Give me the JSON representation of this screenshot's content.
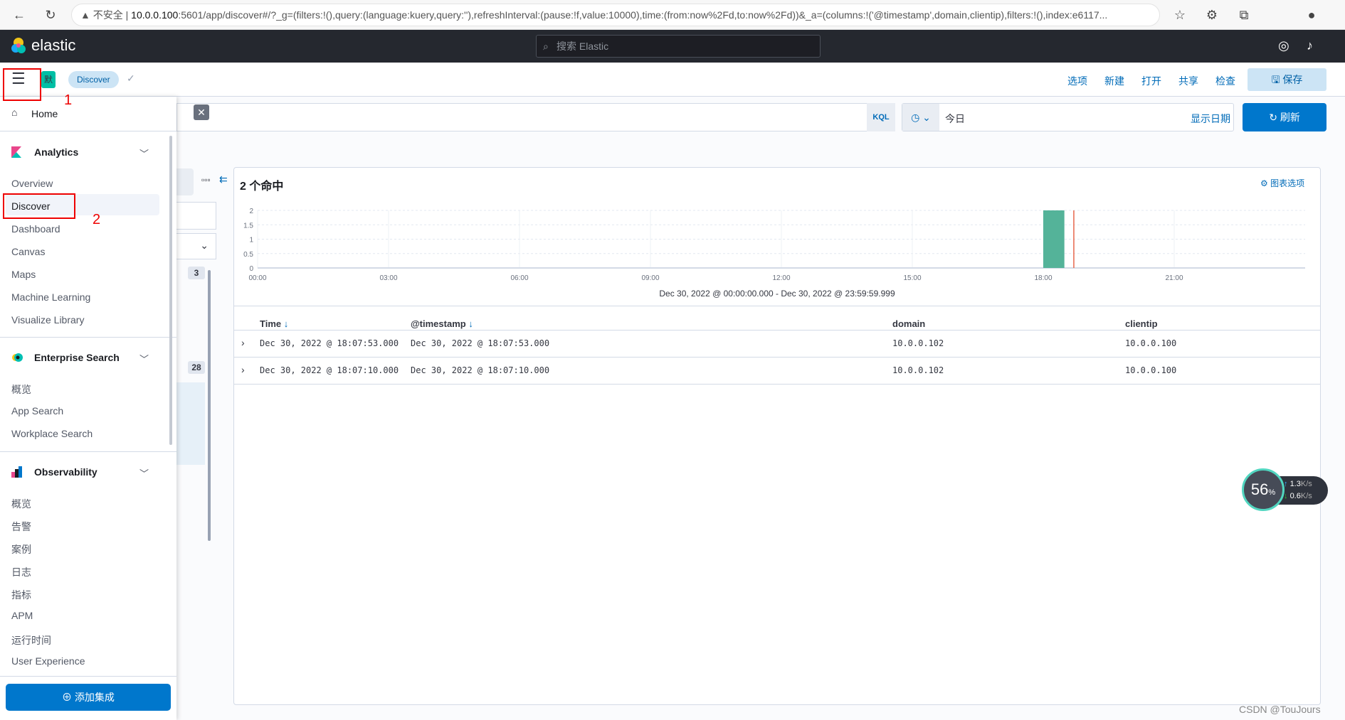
{
  "browser": {
    "security": "不安全",
    "host": "10.0.0.100",
    "url_rest": ":5601/app/discover#/?_g=(filters:!(),query:(language:kuery,query:''),refreshInterval:(pause:!f,value:10000),time:(from:now%2Fd,to:now%2Fd))&_a=(columns:!('@timestamp',domain,clientip),filters:!(),index:e6117..."
  },
  "header": {
    "logo": "elastic",
    "search_placeholder": "搜索 Elastic"
  },
  "subbar": {
    "space_badge": "默",
    "breadcrumb": "Discover",
    "links": [
      "选项",
      "新建",
      "打开",
      "共享",
      "检查"
    ],
    "save": "保存"
  },
  "query": {
    "language": "KQL",
    "date": "今日",
    "show_dates": "显示日期",
    "refresh": "刷新"
  },
  "sidebar": {
    "home": "Home",
    "groups": [
      {
        "title": "Analytics",
        "items": [
          "Overview",
          "Discover",
          "Dashboard",
          "Canvas",
          "Maps",
          "Machine Learning",
          "Visualize Library"
        ]
      },
      {
        "title": "Enterprise Search",
        "items": [
          "概览",
          "App Search",
          "Workplace Search"
        ]
      },
      {
        "title": "Observability",
        "items": [
          "概览",
          "告警",
          "案例",
          "日志",
          "指标",
          "APM",
          "运行时间",
          "User Experience"
        ]
      }
    ],
    "add_integration": "添加集成",
    "active": "Discover"
  },
  "fields": {
    "badge_a": "3",
    "badge_b": "28"
  },
  "annotations": {
    "step1": "1",
    "step2": "2"
  },
  "results": {
    "hits": "2 个命中",
    "chart_options": "图表选项",
    "range": "Dec 30, 2022 @ 00:00:00.000 - Dec 30, 2022 @ 23:59:59.999"
  },
  "chart_data": {
    "type": "bar",
    "x_ticks": [
      "00:00",
      "03:00",
      "06:00",
      "09:00",
      "12:00",
      "15:00",
      "18:00",
      "21:00"
    ],
    "y_ticks": [
      "0",
      "0.5",
      "1",
      "1.5",
      "2"
    ],
    "ylim": [
      0,
      2
    ],
    "xlim": [
      "00:00",
      "24:00"
    ],
    "interval_minutes": 30,
    "bars": [
      {
        "x": "18:00",
        "value": 2
      }
    ],
    "now_marker": "18:42",
    "bar_color": "#54b399",
    "marker_color": "#e7664c",
    "grid": true
  },
  "table": {
    "columns": [
      "Time",
      "@timestamp",
      "domain",
      "clientip"
    ],
    "rows": [
      [
        "Dec 30, 2022 @ 18:07:53.000",
        "Dec 30, 2022 @ 18:07:53.000",
        "10.0.0.102",
        "10.0.0.100"
      ],
      [
        "Dec 30, 2022 @ 18:07:10.000",
        "Dec 30, 2022 @ 18:07:10.000",
        "10.0.0.102",
        "10.0.0.100"
      ]
    ]
  },
  "widget": {
    "percent": "56",
    "pct_sign": "%",
    "up": "1.3",
    "down": "0.6",
    "unit": "K/s"
  },
  "watermark": "CSDN @TouJours"
}
